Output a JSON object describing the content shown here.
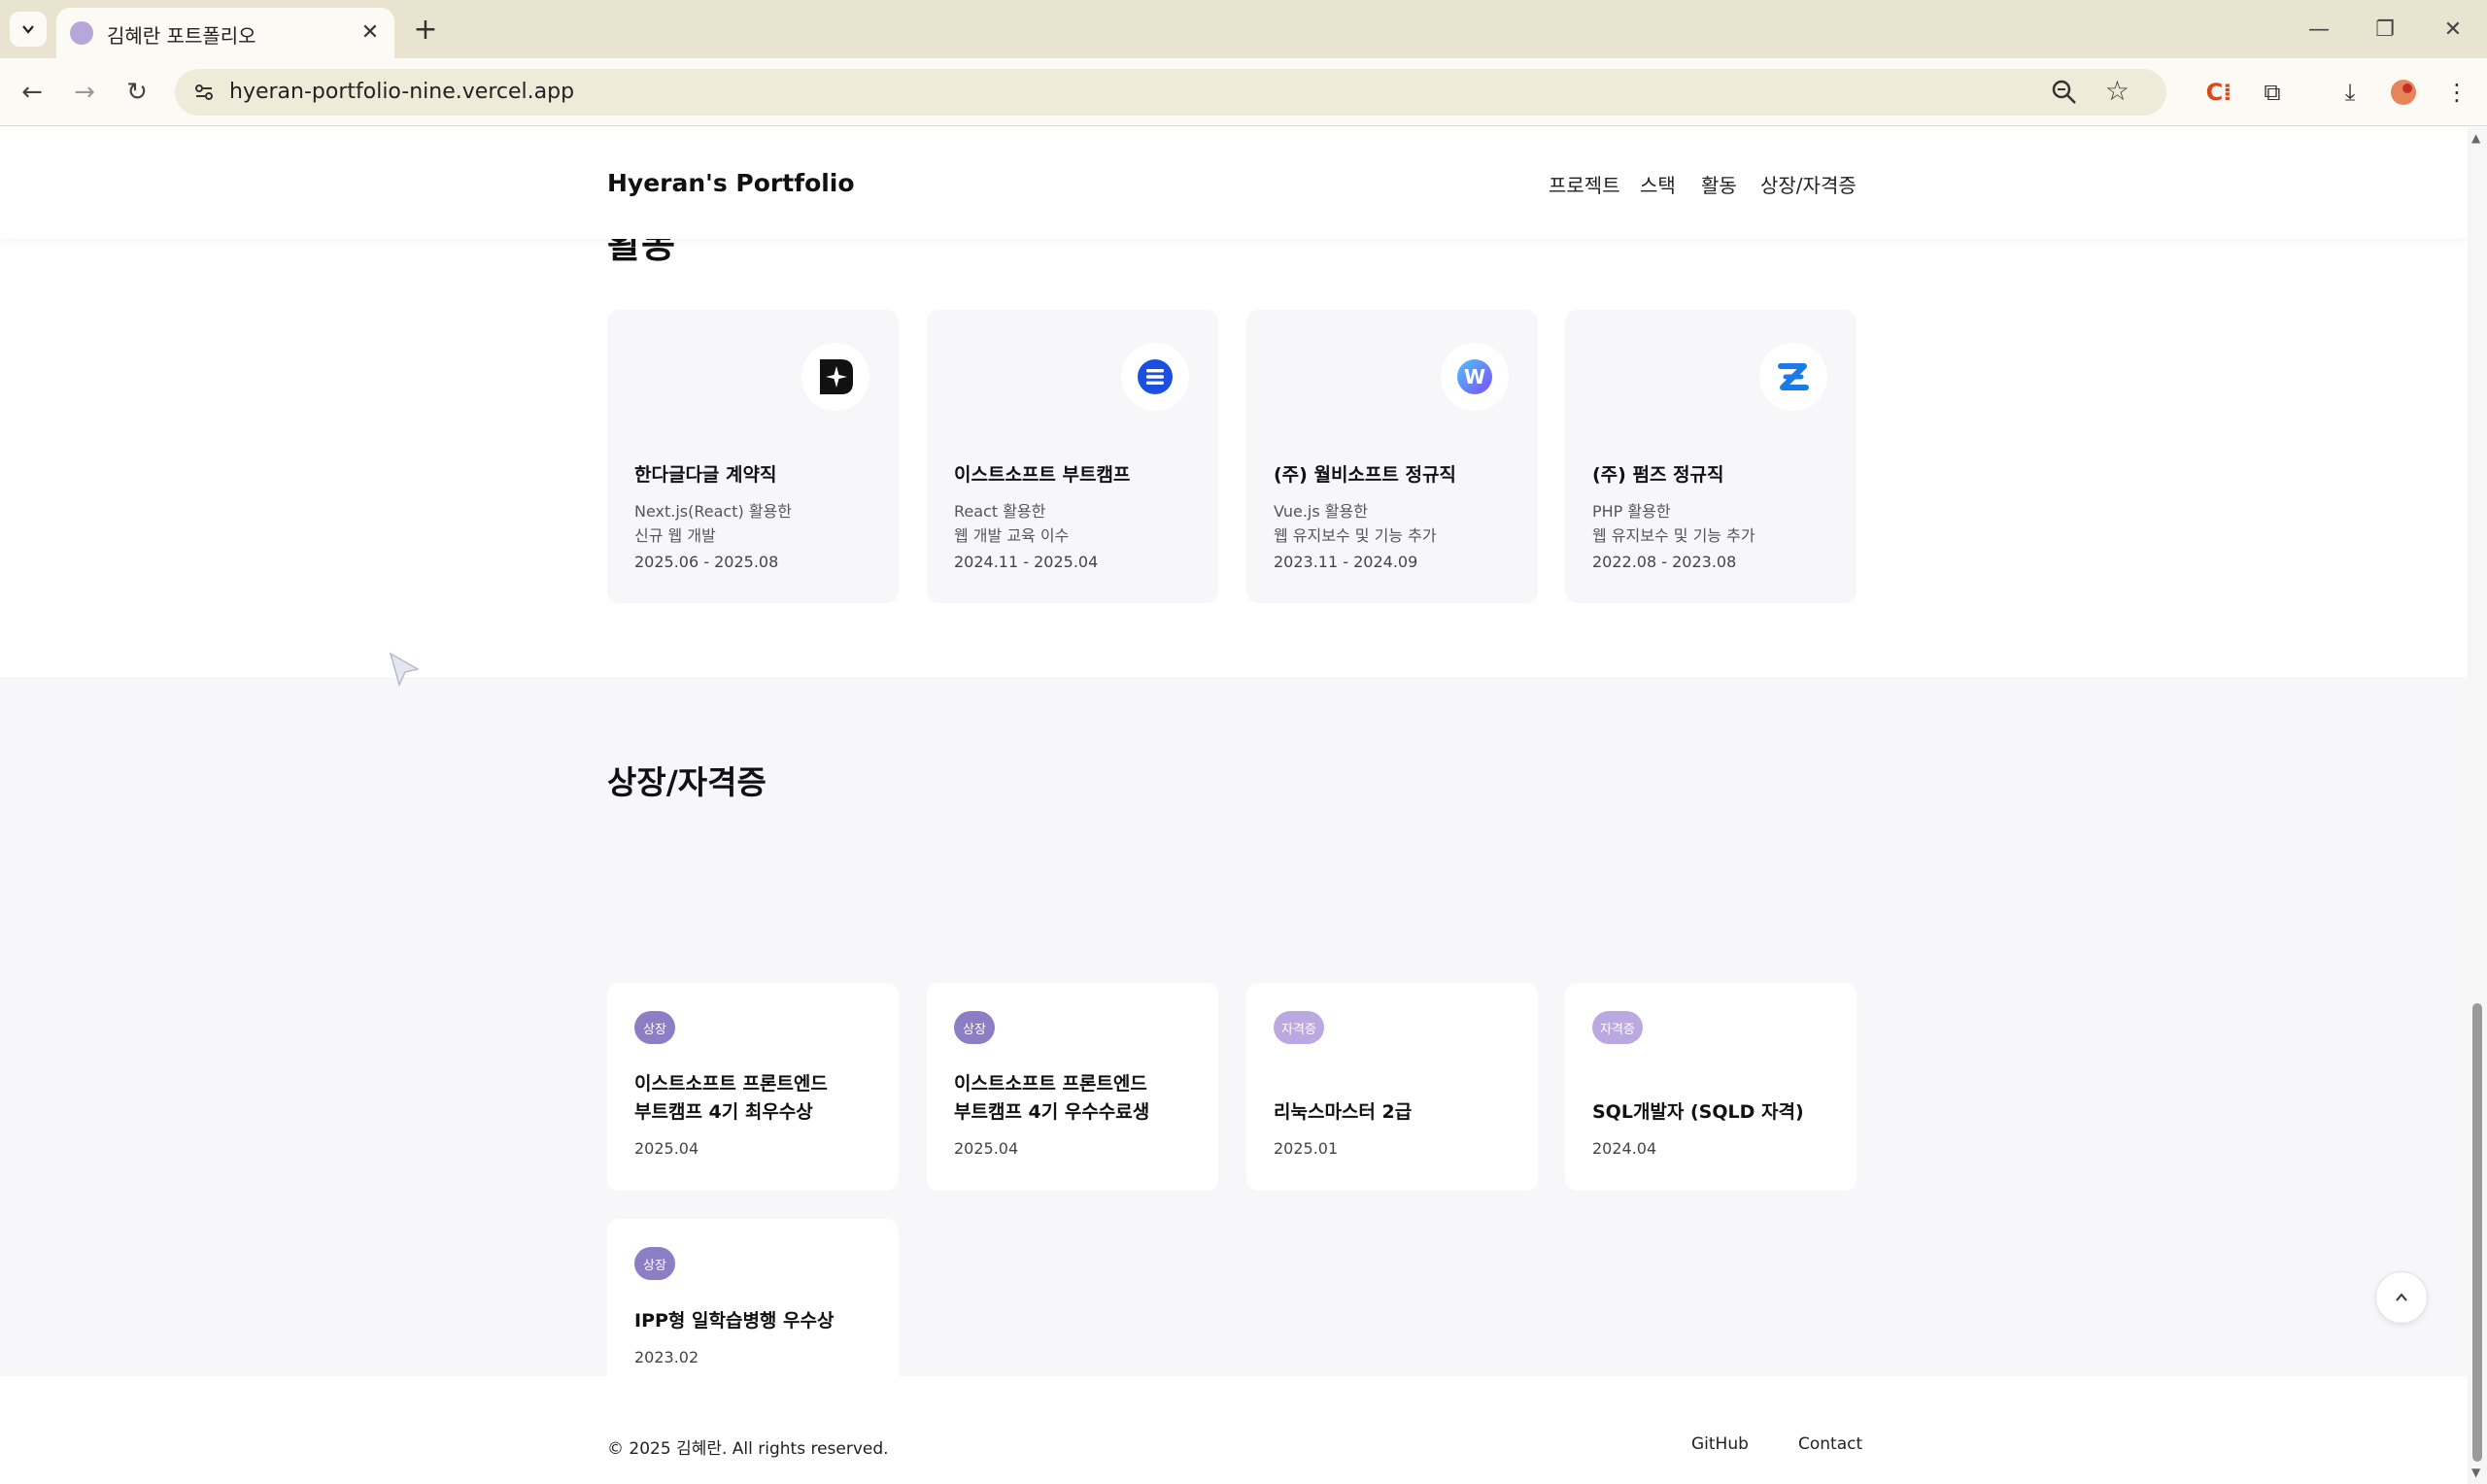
{
  "browser": {
    "tab_title": "김혜란 포트폴리오",
    "url": "hyeran-portfolio-nine.vercel.app"
  },
  "header": {
    "logo": "Hyeran's Portfolio",
    "nav": [
      "프로젝트",
      "스택",
      "활동",
      "상장/자격증"
    ]
  },
  "activities": {
    "partial_heading": "활동",
    "items": [
      {
        "title": "한다글다글 계약직",
        "desc_line1": "Next.js(React) 활용한",
        "desc_line2": "신규 웹 개발",
        "period": "2025.06 - 2025.08",
        "logo": "handageulda-logo-icon",
        "logo_color": "#111111"
      },
      {
        "title": "이스트소프트 부트캠프",
        "desc_line1": "React 활용한",
        "desc_line2": "웹 개발 교육 이수",
        "period": "2024.11 - 2025.04",
        "logo": "estsoft-logo-icon",
        "logo_color": "#1a4fe0"
      },
      {
        "title": "(주) 월비소프트 정규직",
        "desc_line1": "Vue.js 활용한",
        "desc_line2": "웹 유지보수 및 기능 추가",
        "period": "2023.11 - 2024.09",
        "logo": "wolbisoft-logo-icon",
        "logo_color": "#6a5ce0"
      },
      {
        "title": "(주) 펌즈 정규직",
        "desc_line1": "PHP 활용한",
        "desc_line2": "웹 유지보수 및 기능 추가",
        "period": "2022.08 - 2023.08",
        "logo": "firmz-logo-icon",
        "logo_color": "#1a7ae8"
      }
    ]
  },
  "awards": {
    "heading": "상장/자격증",
    "items": [
      {
        "badge": "상장",
        "title_line1": "이스트소프트 프론트엔드",
        "title_line2": "부트캠프 4기 최우수상",
        "date": "2025.04"
      },
      {
        "badge": "상장",
        "title_line1": "이스트소프트 프론트엔드",
        "title_line2": "부트캠프 4기 우수수료생",
        "date": "2025.04"
      },
      {
        "badge": "자격증",
        "title_line1": "",
        "title_line2": "리눅스마스터 2급",
        "date": "2025.01"
      },
      {
        "badge": "자격증",
        "title_line1": "",
        "title_line2": "SQL개발자 (SQLD 자격)",
        "date": "2024.04"
      },
      {
        "badge": "상장",
        "title_line1": "",
        "title_line2": "IPP형 일학습병행 우수상",
        "date": "2023.02"
      }
    ]
  },
  "footer": {
    "copyright": "© 2025 김혜란. All rights reserved.",
    "links": [
      "GitHub",
      "Contact"
    ]
  },
  "colors": {
    "chrome_bg": "#e9e4cf",
    "section_bg": "#f7f7f9",
    "badge_award": "#8c7ec4",
    "badge_cert": "#bba8e0"
  }
}
